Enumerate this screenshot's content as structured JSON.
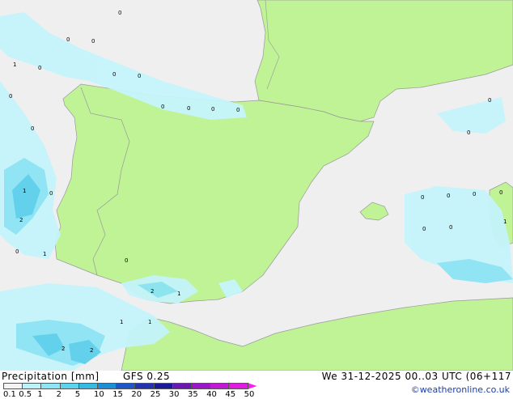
{
  "footer": {
    "title": "Precipitation [mm]",
    "model": "GFS 0.25",
    "datetime": "We 31-12-2025 00..03 UTC (06+117",
    "credit": "©weatheronline.co.uk"
  },
  "legend": {
    "ticks": [
      "0.1",
      "0.5",
      "1",
      "2",
      "5",
      "10",
      "15",
      "20",
      "25",
      "30",
      "35",
      "40",
      "45",
      "50"
    ],
    "colors": [
      "#f4f4f4",
      "#bdf2fb",
      "#8ce6f5",
      "#5dd3ee",
      "#36b9e2",
      "#1c8fd8",
      "#1d56c6",
      "#2233b0",
      "#1b1a96",
      "#6a17b3",
      "#9b16c8",
      "#c219d4",
      "#e21be0",
      "#f61ef0"
    ]
  },
  "map": {
    "colors": {
      "sea": "#efefef",
      "land": "#c0f296",
      "precip_light": "#c5f4fb",
      "precip_mid": "#8be4f4",
      "precip_heavy": "#5cd0ec",
      "border": "#999999"
    },
    "labels": [
      {
        "t": "0"
      },
      {
        "t": "0"
      },
      {
        "t": "0"
      },
      {
        "t": "0"
      },
      {
        "t": "0"
      },
      {
        "t": "0"
      },
      {
        "t": "0"
      },
      {
        "t": "0"
      },
      {
        "t": "0"
      },
      {
        "t": "0"
      },
      {
        "t": "0"
      },
      {
        "t": "0"
      },
      {
        "t": "0"
      },
      {
        "t": "0"
      },
      {
        "t": "0"
      },
      {
        "t": "0"
      },
      {
        "t": "0"
      },
      {
        "t": "0"
      },
      {
        "t": "0"
      },
      {
        "t": "0"
      },
      {
        "t": "0"
      },
      {
        "t": "0"
      },
      {
        "t": "0"
      },
      {
        "t": "1"
      },
      {
        "t": "1"
      },
      {
        "t": "1"
      },
      {
        "t": "1"
      },
      {
        "t": "1"
      },
      {
        "t": "1"
      },
      {
        "t": "1"
      },
      {
        "t": "2"
      },
      {
        "t": "2"
      },
      {
        "t": "2"
      },
      {
        "t": "2"
      }
    ]
  }
}
